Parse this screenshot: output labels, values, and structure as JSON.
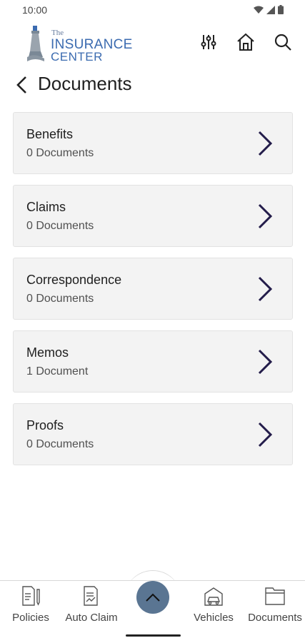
{
  "status_bar": {
    "time": "10:00"
  },
  "logo": {
    "the": "The",
    "line1": "INSURANCE",
    "line2": "CENTER"
  },
  "page": {
    "title": "Documents"
  },
  "documents": [
    {
      "name": "Benefits",
      "count": "0 Documents"
    },
    {
      "name": "Claims",
      "count": "0 Documents"
    },
    {
      "name": "Correspondence",
      "count": "0 Documents"
    },
    {
      "name": "Memos",
      "count": "1 Document"
    },
    {
      "name": "Proofs",
      "count": "0 Documents"
    }
  ],
  "bottom_nav": [
    {
      "label": "Policies",
      "icon": "policies-icon"
    },
    {
      "label": "Auto Claim",
      "icon": "auto-claim-icon"
    },
    {
      "label": "Vehicles",
      "icon": "vehicles-icon"
    },
    {
      "label": "Documents",
      "icon": "documents-folder-icon"
    }
  ],
  "colors": {
    "accent": "#3b6bb0",
    "chevron": "#231c4a",
    "fab": "#5a7592",
    "card": "#f3f3f3"
  }
}
